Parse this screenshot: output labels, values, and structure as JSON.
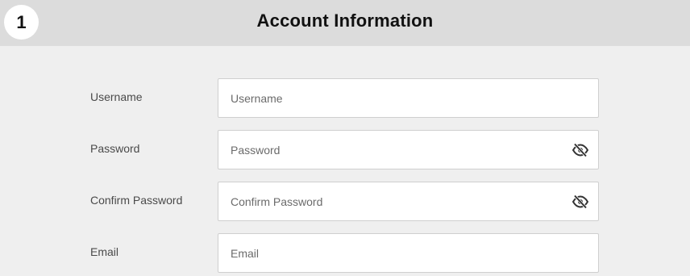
{
  "header": {
    "step_number": "1",
    "title": "Account Information"
  },
  "form": {
    "fields": [
      {
        "label": "Username",
        "placeholder": "Username",
        "value": "",
        "has_visibility_toggle": false
      },
      {
        "label": "Password",
        "placeholder": "Password",
        "value": "",
        "has_visibility_toggle": true,
        "toggle_icon": "eye-slash-icon"
      },
      {
        "label": "Confirm Password",
        "placeholder": "Confirm Password",
        "value": "",
        "has_visibility_toggle": true,
        "toggle_icon": "eye-slash-icon"
      },
      {
        "label": "Email",
        "placeholder": "Email",
        "value": "",
        "has_visibility_toggle": false
      }
    ]
  },
  "colors": {
    "page_background": "#efefef",
    "header_background": "#dcdcdc",
    "input_border": "#cfcfcf",
    "text_dark": "#111111",
    "label_text": "#4a4a4a"
  }
}
